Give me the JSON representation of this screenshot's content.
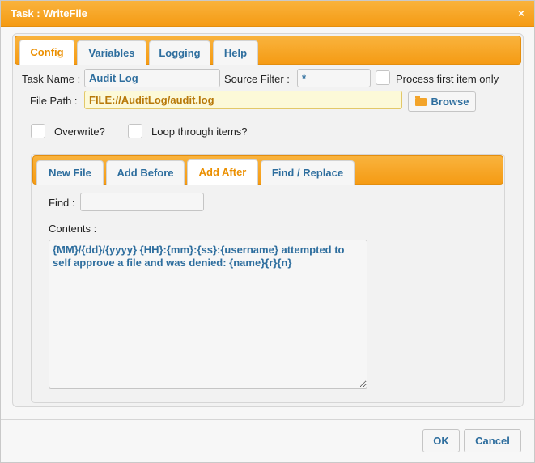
{
  "window": {
    "title": "Task : WriteFile",
    "close_glyph": "×"
  },
  "tabs": [
    {
      "label": "Config",
      "active": true
    },
    {
      "label": "Variables",
      "active": false
    },
    {
      "label": "Logging",
      "active": false
    },
    {
      "label": "Help",
      "active": false
    }
  ],
  "config": {
    "task_name_label": "Task Name :",
    "task_name_value": "Audit Log",
    "source_filter_label": "Source Filter :",
    "source_filter_value": "*",
    "process_first_label": "Process first item only",
    "file_path_label": "File Path :",
    "file_path_value": "FILE://AuditLog/audit.log",
    "browse_label": "Browse",
    "overwrite_label": "Overwrite?",
    "loop_label": "Loop through items?"
  },
  "subtabs": [
    {
      "label": "New File",
      "active": false
    },
    {
      "label": "Add Before",
      "active": false
    },
    {
      "label": "Add After",
      "active": true
    },
    {
      "label": "Find / Replace",
      "active": false
    }
  ],
  "add_after": {
    "find_label": "Find :",
    "find_value": "",
    "contents_label": "Contents :",
    "contents_value": "{MM}/{dd}/{yyyy} {HH}:{mm}:{ss}:{username} attempted to self approve a file and was denied: {name}{r}{n}"
  },
  "footer": {
    "ok_label": "OK",
    "cancel_label": "Cancel"
  },
  "colors": {
    "accent": "#f59b14",
    "link_text": "#2e6e9e",
    "active_tab_text": "#eb8f00"
  },
  "icons": {
    "browse": "folder-icon",
    "close": "close-icon"
  }
}
